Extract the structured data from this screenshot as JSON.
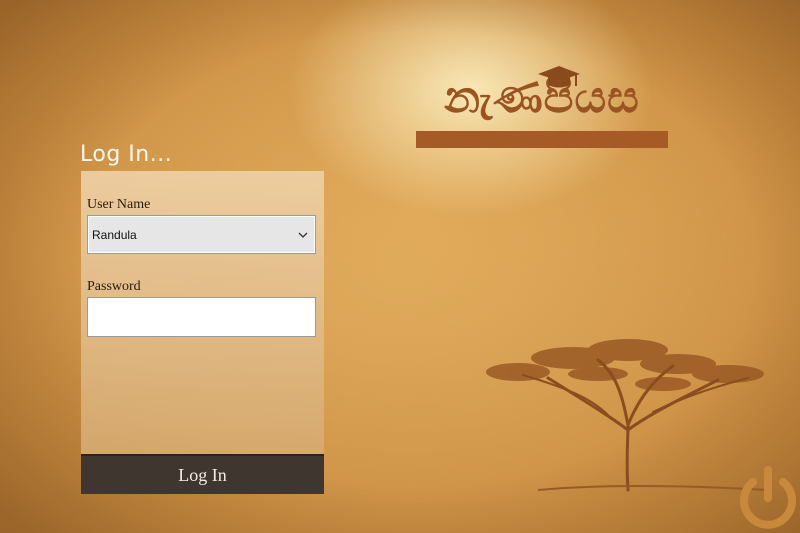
{
  "logo": {
    "text": "නැණපියස",
    "alt_name": "graduation-cap"
  },
  "login": {
    "title": "Log In...",
    "username_label": "User Name",
    "username_value": "Randula",
    "password_label": "Password",
    "password_value": "",
    "submit_label": "Log In"
  },
  "colors": {
    "background": "#c88a3e",
    "logo_brown": "#a65a26",
    "button_bg": "#3f3630",
    "power_icon": "#c8893a"
  },
  "icons": [
    "graduation-cap-icon",
    "chevron-down-icon",
    "acacia-tree-illustration",
    "power-icon"
  ]
}
